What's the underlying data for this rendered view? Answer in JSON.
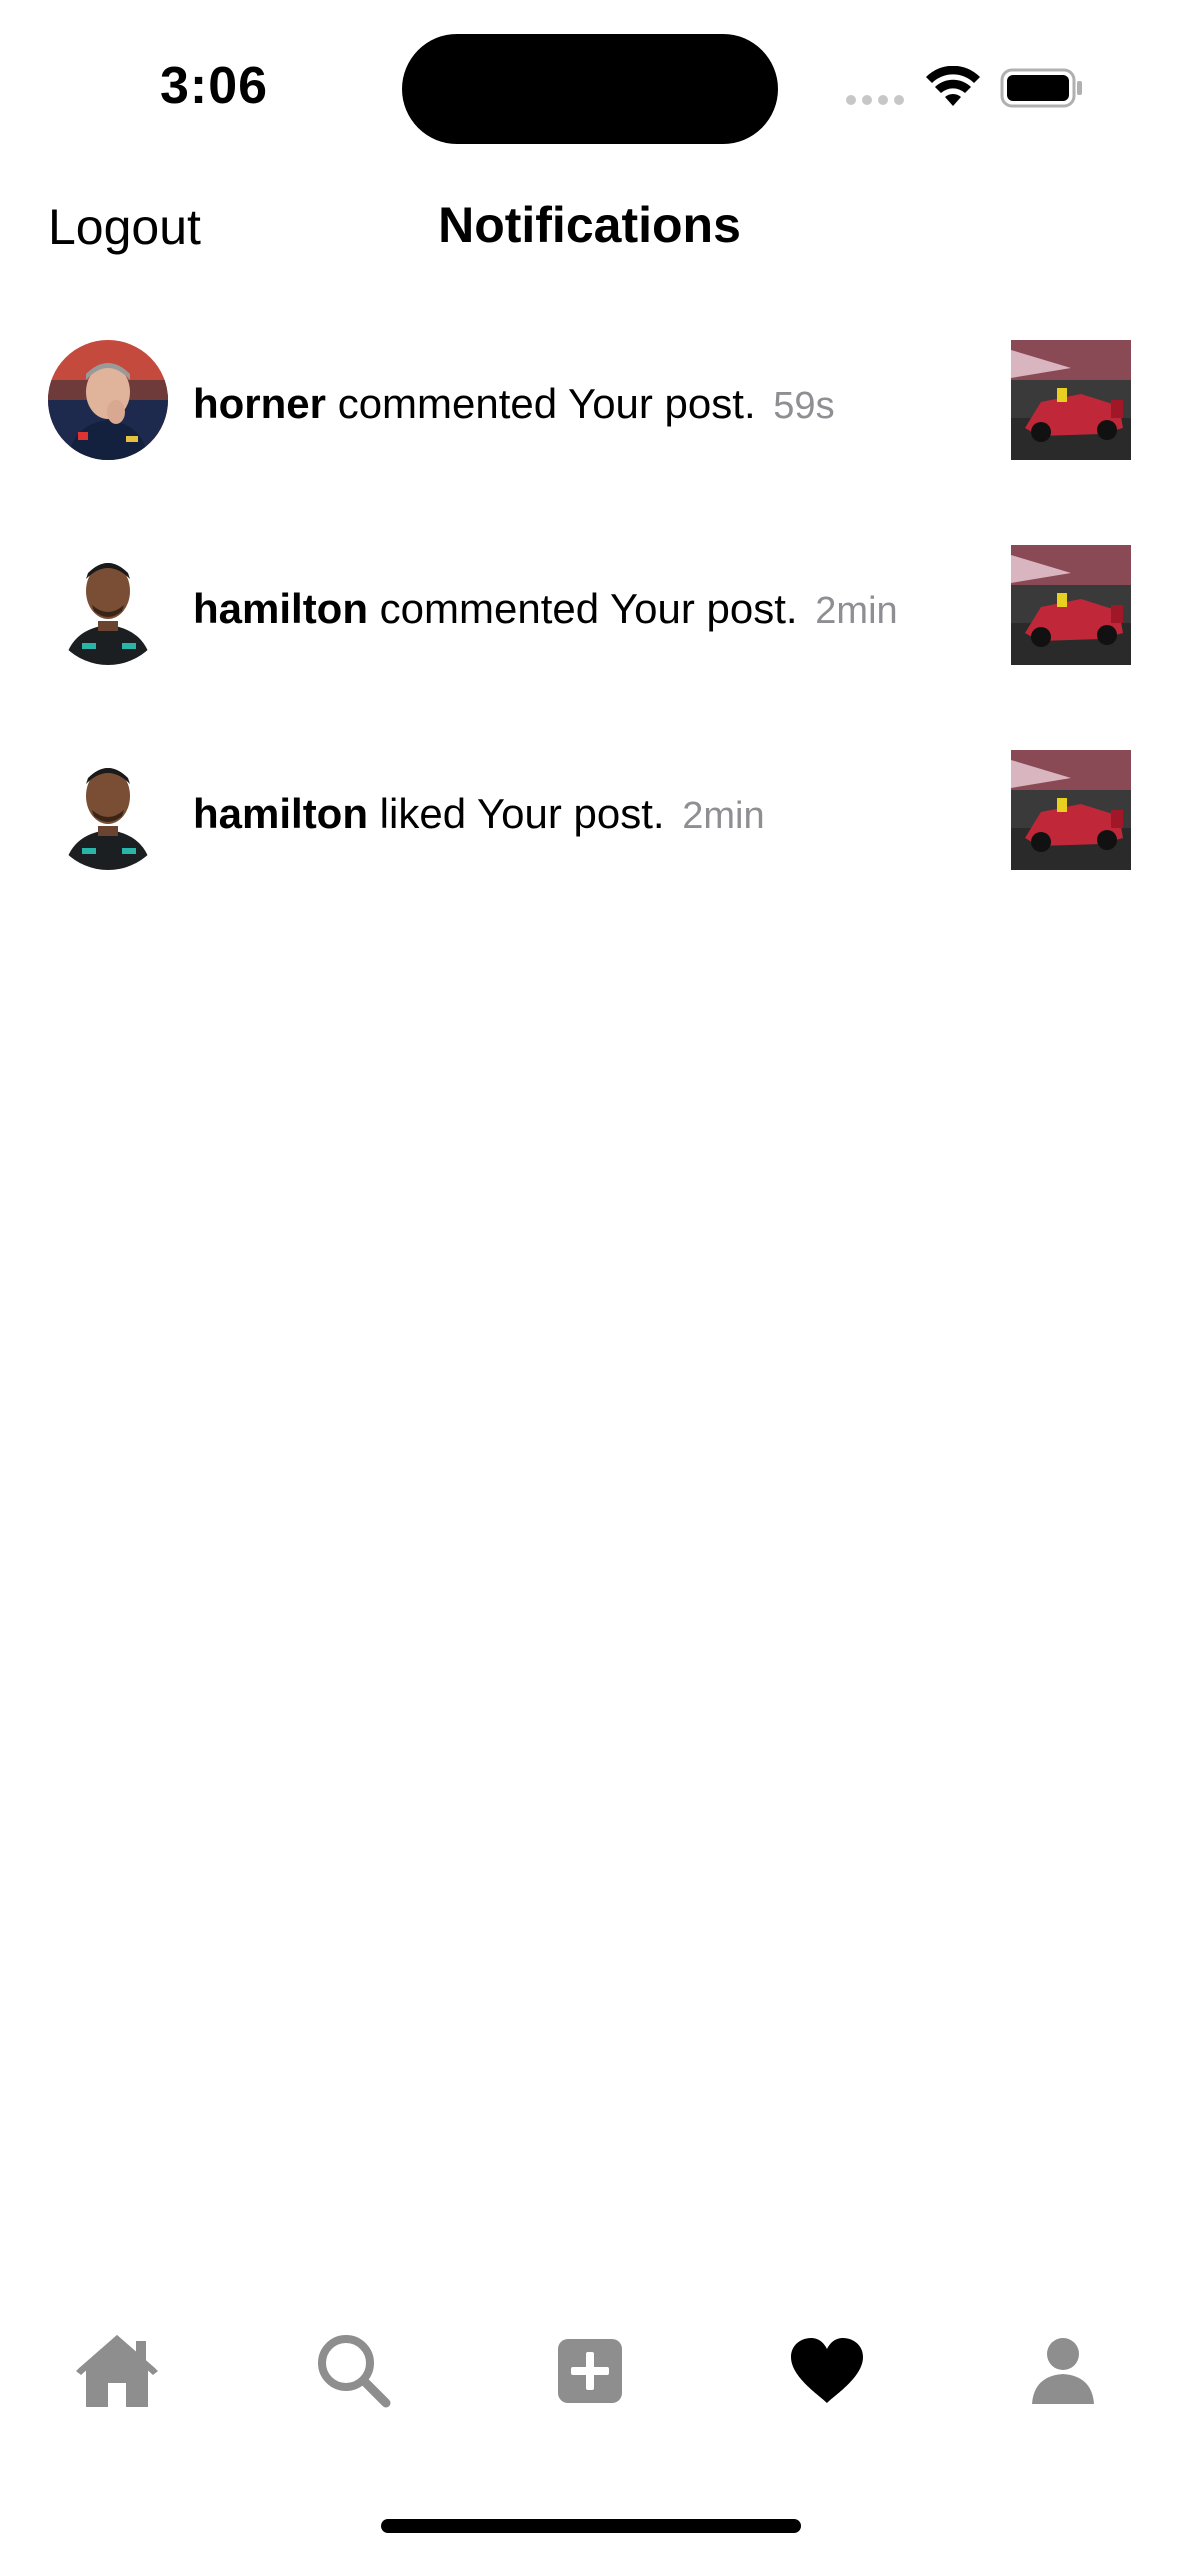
{
  "status_bar": {
    "time": "3:06"
  },
  "nav": {
    "logout_label": "Logout",
    "title": "Notifications"
  },
  "notifications": [
    {
      "username": "horner",
      "action": "commented Your post.",
      "time": "59s",
      "avatar": "horner-avatar",
      "thumbnail": "race-car-thumbnail"
    },
    {
      "username": "hamilton",
      "action": "commented Your post.",
      "time": "2min",
      "avatar": "hamilton-avatar",
      "thumbnail": "race-car-thumbnail"
    },
    {
      "username": "hamilton",
      "action": "liked Your post.",
      "time": "2min",
      "avatar": "hamilton-avatar",
      "thumbnail": "race-car-thumbnail"
    }
  ],
  "tab_bar": {
    "items": [
      {
        "icon": "home-icon",
        "active": false
      },
      {
        "icon": "search-icon",
        "active": false
      },
      {
        "icon": "add-post-icon",
        "active": false
      },
      {
        "icon": "heart-icon",
        "active": true
      },
      {
        "icon": "profile-icon",
        "active": false
      }
    ],
    "active_color": "#000000",
    "inactive_color": "#8e8e8e"
  }
}
